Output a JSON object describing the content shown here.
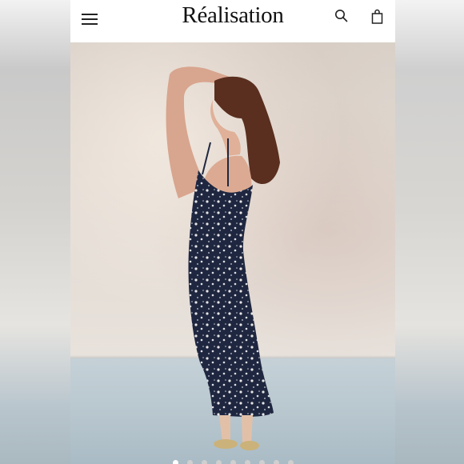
{
  "brand": "Réalisation",
  "header": {
    "menu_icon": "hamburger-menu-icon",
    "search_icon": "search-icon",
    "bag_icon": "shopping-bag-icon"
  },
  "hero": {
    "image": "model-in-floral-slip-dress-photo"
  },
  "carousel": {
    "total": 9,
    "active_index": 0
  },
  "colors": {
    "header_bg": "#ffffff",
    "dress": "#1f2740",
    "wall": "#e2dad2",
    "floor": "#b6c5cd"
  }
}
